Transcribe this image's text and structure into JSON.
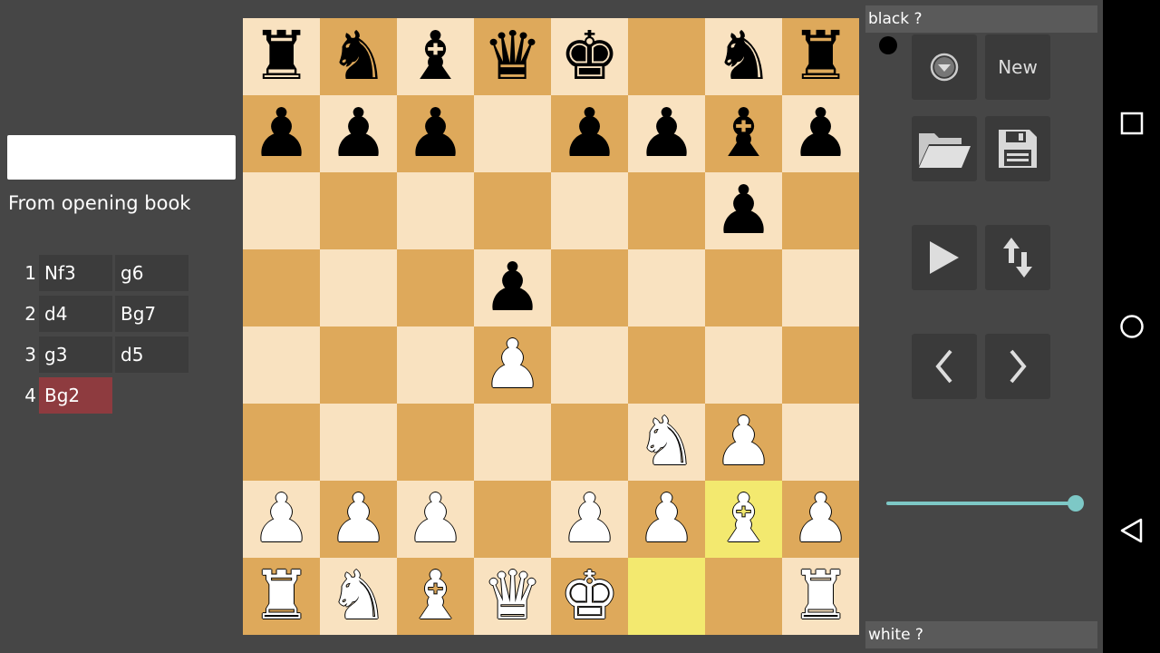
{
  "left": {
    "search_value": "",
    "book_label": "From opening book",
    "moves": [
      {
        "num": "1",
        "white": "Nf3",
        "black": "g6"
      },
      {
        "num": "2",
        "white": "d4",
        "black": "Bg7"
      },
      {
        "num": "3",
        "white": "g3",
        "black": "d5"
      },
      {
        "num": "4",
        "white": "Bg2",
        "black": ""
      }
    ]
  },
  "board": {
    "rows": [
      [
        "br",
        "bn",
        "bb",
        "bq",
        "bk",
        "",
        "bn",
        "br"
      ],
      [
        "bp",
        "bp",
        "bp",
        "",
        "bp",
        "bp",
        "bb",
        "bp"
      ],
      [
        "",
        "",
        "",
        "",
        "",
        "",
        "bp",
        ""
      ],
      [
        "",
        "",
        "",
        "bp",
        "",
        "",
        "",
        ""
      ],
      [
        "",
        "",
        "",
        "wp",
        "",
        "",
        "",
        ""
      ],
      [
        "",
        "",
        "",
        "",
        "",
        "wn",
        "wp",
        ""
      ],
      [
        "wp",
        "wp",
        "wp",
        "",
        "wp",
        "wp",
        "wb",
        "wp"
      ],
      [
        "wr",
        "wn",
        "wb",
        "wq",
        "wk",
        "",
        "",
        "wr"
      ]
    ],
    "highlight": [
      [
        6,
        6
      ],
      [
        7,
        5
      ]
    ],
    "colors": {
      "light": "#f9e2c0",
      "dark": "#dea95b",
      "highlight": "#f3e96f"
    }
  },
  "right": {
    "black_player": "black ?",
    "white_player": "white ?",
    "new_label": "New",
    "turn": "black",
    "slider_value": 1.0,
    "icons": {
      "menu": "dropdown-circle-icon",
      "load": "folder-icon",
      "save": "save-icon",
      "play": "play-icon",
      "flip": "flip-arrows-icon",
      "back": "chevron-left-icon",
      "forward": "chevron-right-icon"
    }
  },
  "navbar": {
    "icons": [
      "recent-apps-icon",
      "home-icon",
      "back-icon"
    ]
  }
}
